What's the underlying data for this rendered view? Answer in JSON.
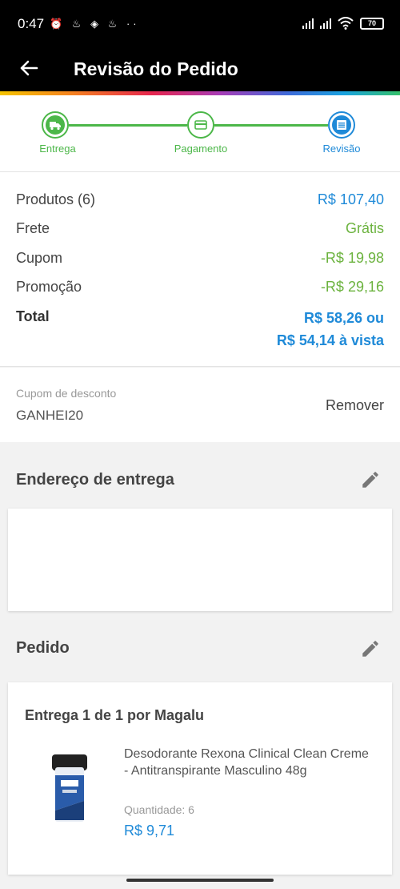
{
  "status_bar": {
    "time": "0:47",
    "notification_icons": "⏰ ♨ ◈ ♨ ··",
    "battery": "70"
  },
  "app_bar": {
    "title": "Revisão do Pedido",
    "back_icon": "arrow-left-icon"
  },
  "stepper": {
    "steps": [
      {
        "label": "Entrega",
        "icon": "truck-icon"
      },
      {
        "label": "Pagamento",
        "icon": "card-icon"
      },
      {
        "label": "Revisão",
        "icon": "list-icon"
      }
    ]
  },
  "summary": {
    "products_label": "Produtos (6)",
    "products_value": "R$ 107,40",
    "shipping_label": "Frete",
    "shipping_value": "Grátis",
    "coupon_label": "Cupom",
    "coupon_value": "-R$ 19,98",
    "promo_label": "Promoção",
    "promo_value": "-R$ 29,16",
    "total_label": "Total",
    "total_value_line1": "R$ 58,26 ou",
    "total_value_line2": "R$ 54,14 à vista"
  },
  "coupon": {
    "label": "Cupom de desconto",
    "code": "GANHEI20",
    "remove_label": "Remover"
  },
  "address_section": {
    "title": "Endereço de entrega",
    "edit_icon": "pencil-icon"
  },
  "order_section": {
    "title": "Pedido",
    "edit_icon": "pencil-icon",
    "delivery_label": "Entrega 1 de 1 por Magalu",
    "product": {
      "name": "Desodorante Rexona Clinical Clean Creme - Antitranspirante Masculino 48g",
      "quantity": "Quantidade:  6",
      "price": "R$ 9,71"
    }
  },
  "colors": {
    "green": "#4cb749",
    "blue": "#1f8ad8",
    "discount_green": "#6cb33f"
  }
}
